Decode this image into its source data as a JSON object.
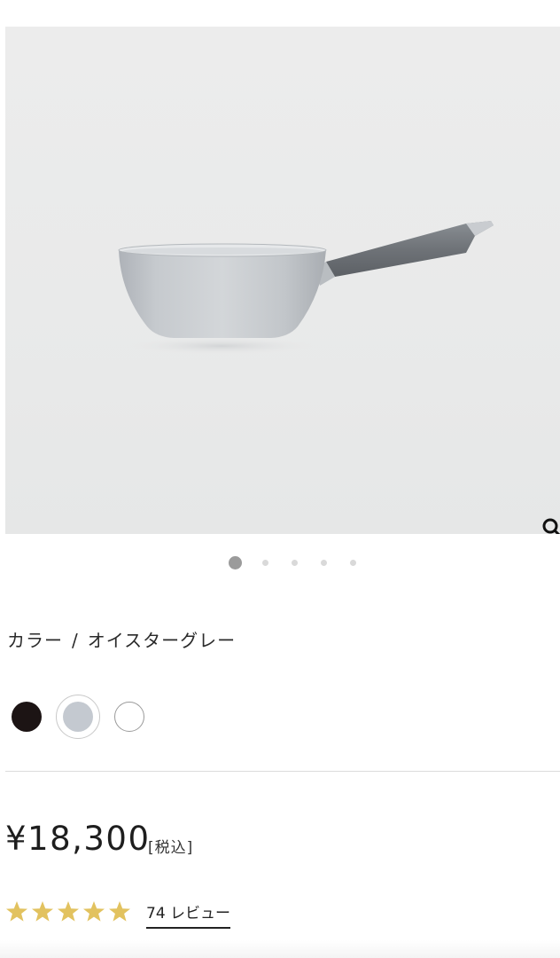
{
  "product": {
    "image_alt": "product-photo-saucepan",
    "carousel": {
      "count": 5,
      "active_index": 0
    }
  },
  "color": {
    "label": "カラー",
    "separator": "/",
    "selected_name": "オイスターグレー",
    "swatches": [
      {
        "name": "black",
        "hex": "#1c1414",
        "selected": false
      },
      {
        "name": "oyster-grey",
        "hex": "#c4c9d0",
        "selected": true
      },
      {
        "name": "white",
        "hex": "#ffffff",
        "selected": false
      }
    ]
  },
  "price": {
    "amount": "¥18,300",
    "tax_note": "[税込]"
  },
  "rating": {
    "stars": 5,
    "star_color": "#e2c25f",
    "review_count_label": "74 レビュー"
  },
  "icons": {
    "zoom": "magnifier-icon"
  }
}
